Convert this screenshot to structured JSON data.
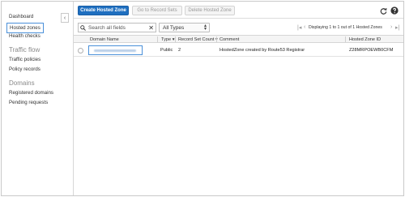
{
  "sidebar": {
    "items_top": [
      {
        "label": "Dashboard"
      },
      {
        "label": "Hosted zones",
        "active": true
      },
      {
        "label": "Health checks"
      }
    ],
    "traffic_heading": "Traffic flow",
    "traffic_items": [
      {
        "label": "Traffic policies"
      },
      {
        "label": "Policy records"
      }
    ],
    "domains_heading": "Domains",
    "domains_items": [
      {
        "label": "Registered domains"
      },
      {
        "label": "Pending requests"
      }
    ],
    "collapse_glyph": "‹"
  },
  "toolbar": {
    "create_label": "Create Hosted Zone",
    "goto_label": "Go to Record Sets",
    "delete_label": "Delete Hosted Zone"
  },
  "filter": {
    "search_placeholder": "Search all fields",
    "type_value": "All Types"
  },
  "pager": {
    "text": "Displaying 1 to 1 out of 1 Hosted Zones"
  },
  "table": {
    "headers": [
      "Domain Name",
      "Type",
      "Record Set Count",
      "Comment",
      "Hosted Zone ID"
    ],
    "rows": [
      {
        "domain": "",
        "type": "Public",
        "count": "2",
        "comment": "HostedZone created by Route53 Registrar",
        "zone_id": "Z28MRPOEWB0CFM"
      }
    ]
  },
  "colors": {
    "primary": "#1f6fc0",
    "active_border": "#4a90d9"
  }
}
